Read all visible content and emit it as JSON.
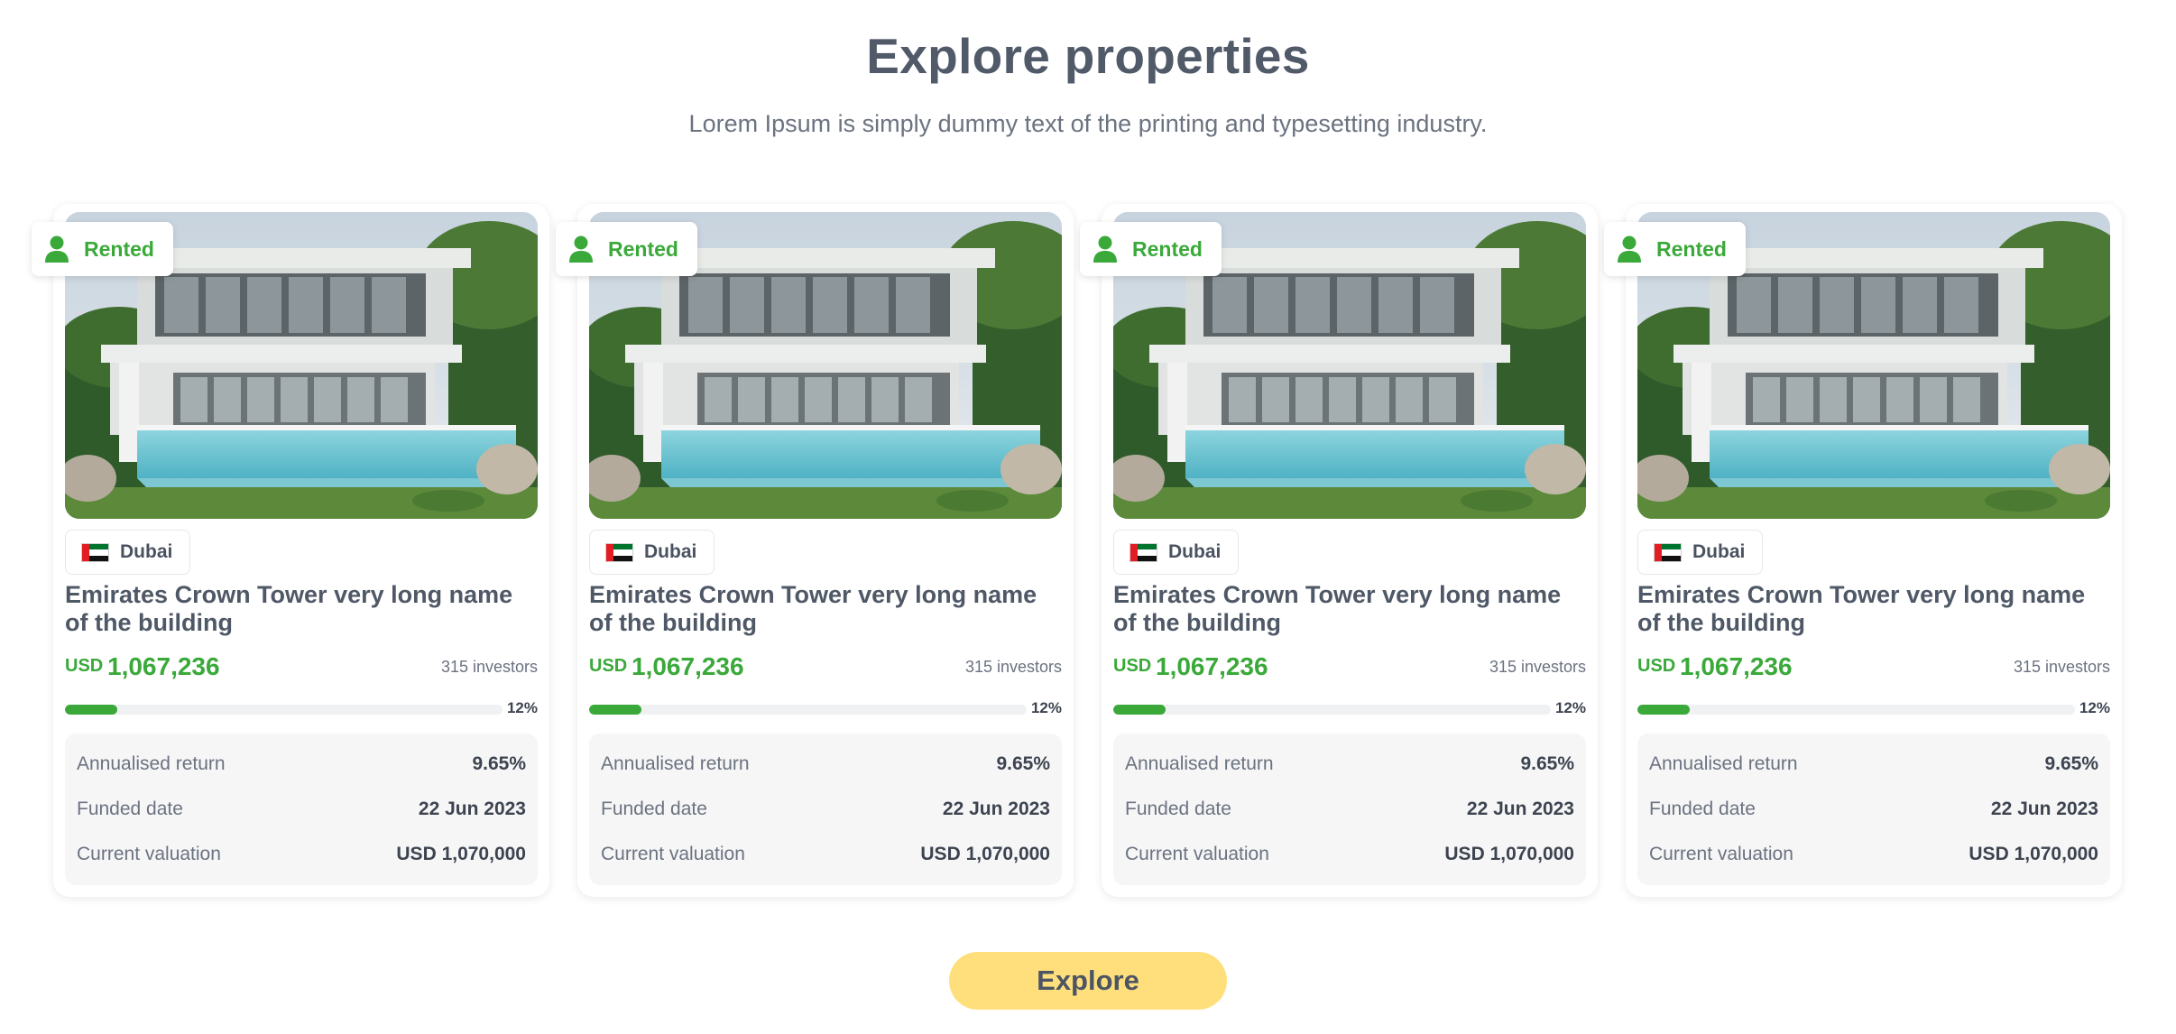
{
  "header": {
    "title": "Explore properties",
    "subtitle": "Lorem Ipsum is simply dummy text of the printing and typesetting industry."
  },
  "icons": {
    "status": "person-icon",
    "flag": "uae-flag-icon"
  },
  "colors": {
    "accent_green": "#3aa93a",
    "button_yellow": "#fedf7b",
    "text_dark": "#4f5866"
  },
  "properties": [
    {
      "status": "Rented",
      "location": "Dubai",
      "name": "Emirates Crown Tower very long name of the building",
      "currency": "USD",
      "amount": "1,067,236",
      "investors": "315 investors",
      "progress_label": "12%",
      "progress": 0.12,
      "stats": [
        {
          "label": "Annualised return",
          "value": "9.65%"
        },
        {
          "label": "Funded date",
          "value": "22 Jun 2023"
        },
        {
          "label": "Current valuation",
          "value": "USD 1,070,000"
        }
      ]
    },
    {
      "status": "Rented",
      "location": "Dubai",
      "name": "Emirates Crown Tower very long name of the building",
      "currency": "USD",
      "amount": "1,067,236",
      "investors": "315 investors",
      "progress_label": "12%",
      "progress": 0.12,
      "stats": [
        {
          "label": "Annualised return",
          "value": "9.65%"
        },
        {
          "label": "Funded date",
          "value": "22 Jun 2023"
        },
        {
          "label": "Current valuation",
          "value": "USD 1,070,000"
        }
      ]
    },
    {
      "status": "Rented",
      "location": "Dubai",
      "name": "Emirates Crown Tower very long name of the building",
      "currency": "USD",
      "amount": "1,067,236",
      "investors": "315 investors",
      "progress_label": "12%",
      "progress": 0.12,
      "stats": [
        {
          "label": "Annualised return",
          "value": "9.65%"
        },
        {
          "label": "Funded date",
          "value": "22 Jun 2023"
        },
        {
          "label": "Current valuation",
          "value": "USD 1,070,000"
        }
      ]
    },
    {
      "status": "Rented",
      "location": "Dubai",
      "name": "Emirates Crown Tower very long name of the building",
      "currency": "USD",
      "amount": "1,067,236",
      "investors": "315 investors",
      "progress_label": "12%",
      "progress": 0.12,
      "stats": [
        {
          "label": "Annualised return",
          "value": "9.65%"
        },
        {
          "label": "Funded date",
          "value": "22 Jun 2023"
        },
        {
          "label": "Current valuation",
          "value": "USD 1,070,000"
        }
      ]
    }
  ],
  "cta": {
    "label": "Explore"
  }
}
